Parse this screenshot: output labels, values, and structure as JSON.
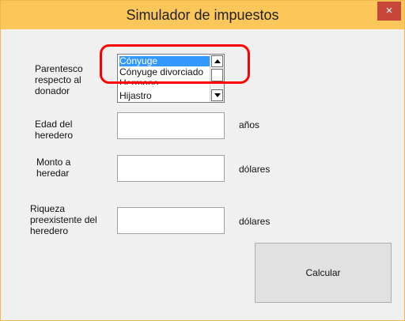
{
  "window": {
    "title": "Simulador de impuestos",
    "close_symbol": "×",
    "titlebar_color": "#fbc75a",
    "close_color": "#c8453a"
  },
  "form": {
    "parentesco_label": "Parentesco respecto al donador",
    "parentesco_options": [
      "Cónyuge",
      "Cónyuge divorciado",
      "Hermano",
      "Hijastro"
    ],
    "parentesco_selected": "Cónyuge",
    "edad_label": "Edad del heredero",
    "edad_value": "",
    "edad_unit": "años",
    "monto_label": "Monto a heredar",
    "monto_value": "",
    "monto_unit": "dólares",
    "riqueza_label": "Riqueza preexistente del heredero",
    "riqueza_value": "",
    "riqueza_unit": "dólares",
    "calcular_label": "Calcular"
  },
  "annotation": {
    "highlight_color": "#ff0000"
  }
}
